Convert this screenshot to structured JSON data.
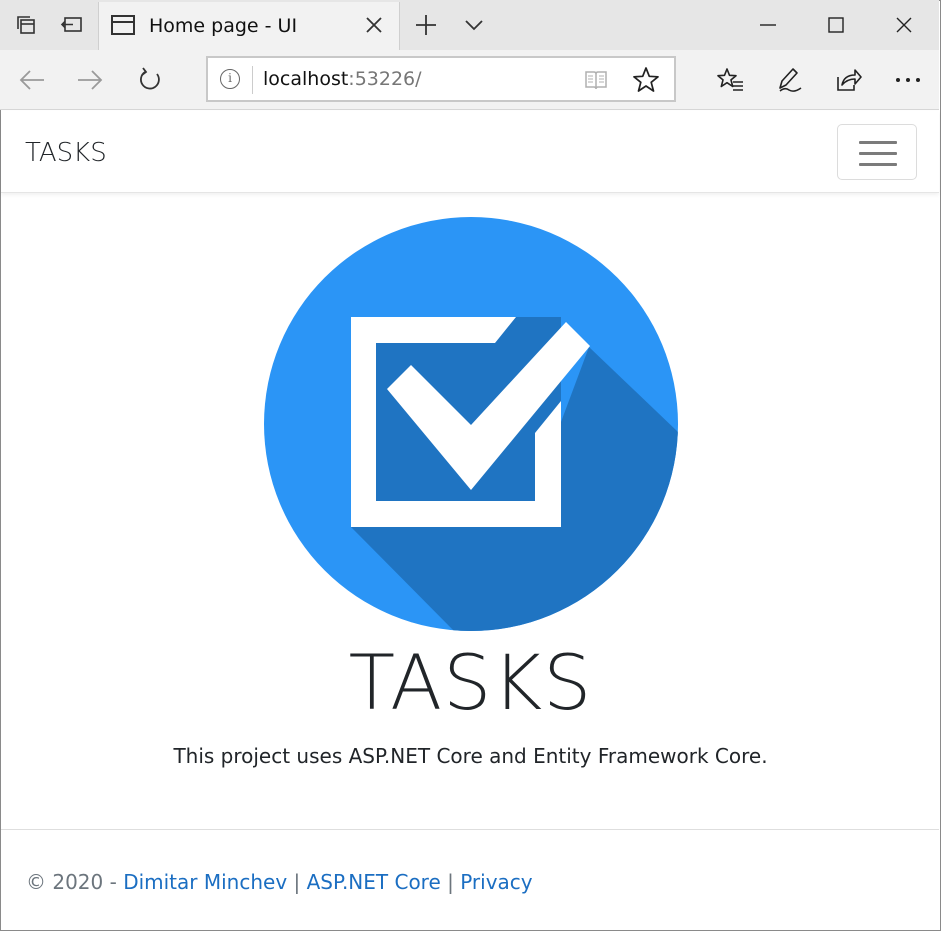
{
  "browser": {
    "tab_title": "Home page - UI",
    "address_host": "localhost",
    "address_rest": ":53226/",
    "colors": {
      "tabstrip": "#e6e6e6",
      "toolbar": "#f2f2f2"
    }
  },
  "navbar": {
    "brand": "TASKS"
  },
  "hero": {
    "title": "TASKS",
    "subtitle": "This project uses ASP.NET Core and Entity Framework Core.",
    "logo_colors": {
      "circle": "#2b95f6",
      "shadow": "#1f74c2",
      "mark": "#ffffff"
    }
  },
  "footer": {
    "copyright": "© 2020 - ",
    "author": "Dimitar Minchev",
    "sep1": " | ",
    "framework": "ASP.NET Core",
    "sep2": " | ",
    "privacy": "Privacy",
    "link_color": "#1b6ec2"
  }
}
